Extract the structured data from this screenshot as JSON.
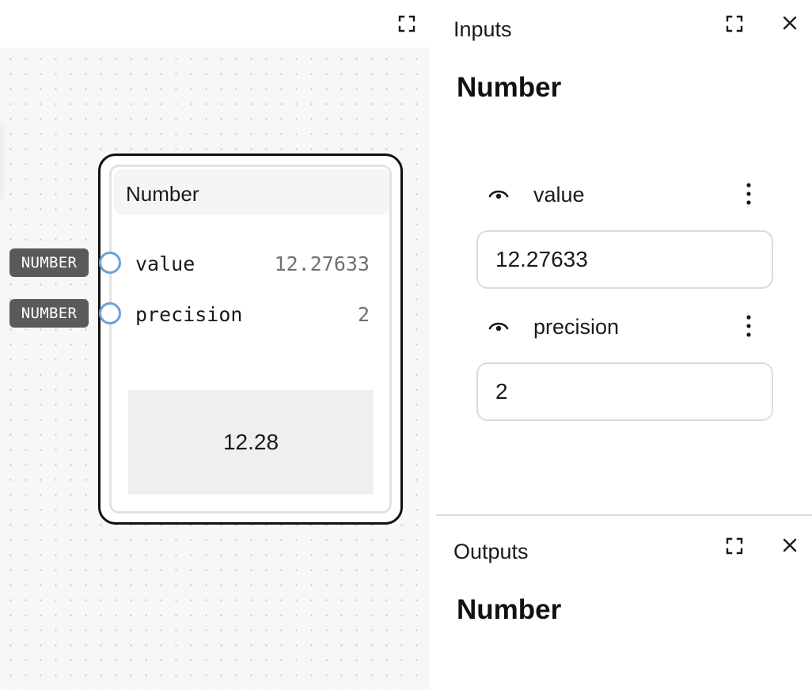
{
  "canvas": {
    "expand_icon": "expand-icon",
    "node": {
      "title": "Number",
      "params": [
        {
          "name": "value",
          "value": "12.27633",
          "type_badge": "NUMBER"
        },
        {
          "name": "precision",
          "value": "2",
          "type_badge": "NUMBER"
        }
      ],
      "output_value": "12.28"
    }
  },
  "inspector": {
    "inputs_panel": {
      "title": "Inputs",
      "node_name": "Number",
      "fields": [
        {
          "label": "value",
          "input_value": "12.27633"
        },
        {
          "label": "precision",
          "input_value": "2"
        }
      ]
    },
    "outputs_panel": {
      "title": "Outputs",
      "node_name": "Number"
    }
  },
  "colors": {
    "port_stroke": "#6e9fd6",
    "badge_bg": "#5a5a5a",
    "canvas_bg": "#f7f7f7",
    "node_border": "#111111"
  }
}
